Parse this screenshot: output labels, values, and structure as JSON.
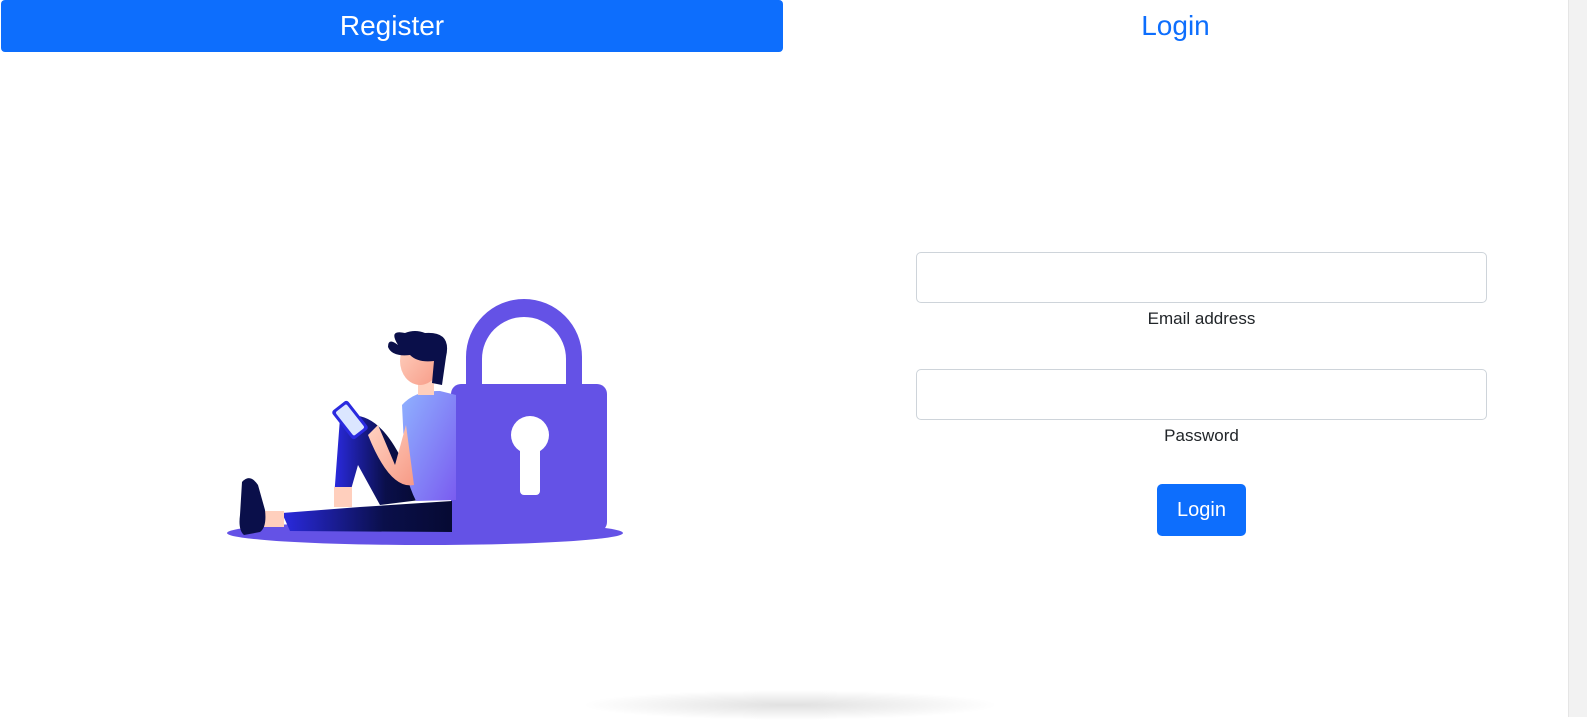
{
  "tabs": {
    "register": "Register",
    "login": "Login"
  },
  "form": {
    "email_label": "Email address",
    "email_value": "",
    "password_label": "Password",
    "password_value": "",
    "submit_label": "Login"
  },
  "colors": {
    "primary": "#0d6efd",
    "lock": "#6452e6"
  },
  "icons": {
    "illustration": "person-with-padlock-illustration"
  }
}
